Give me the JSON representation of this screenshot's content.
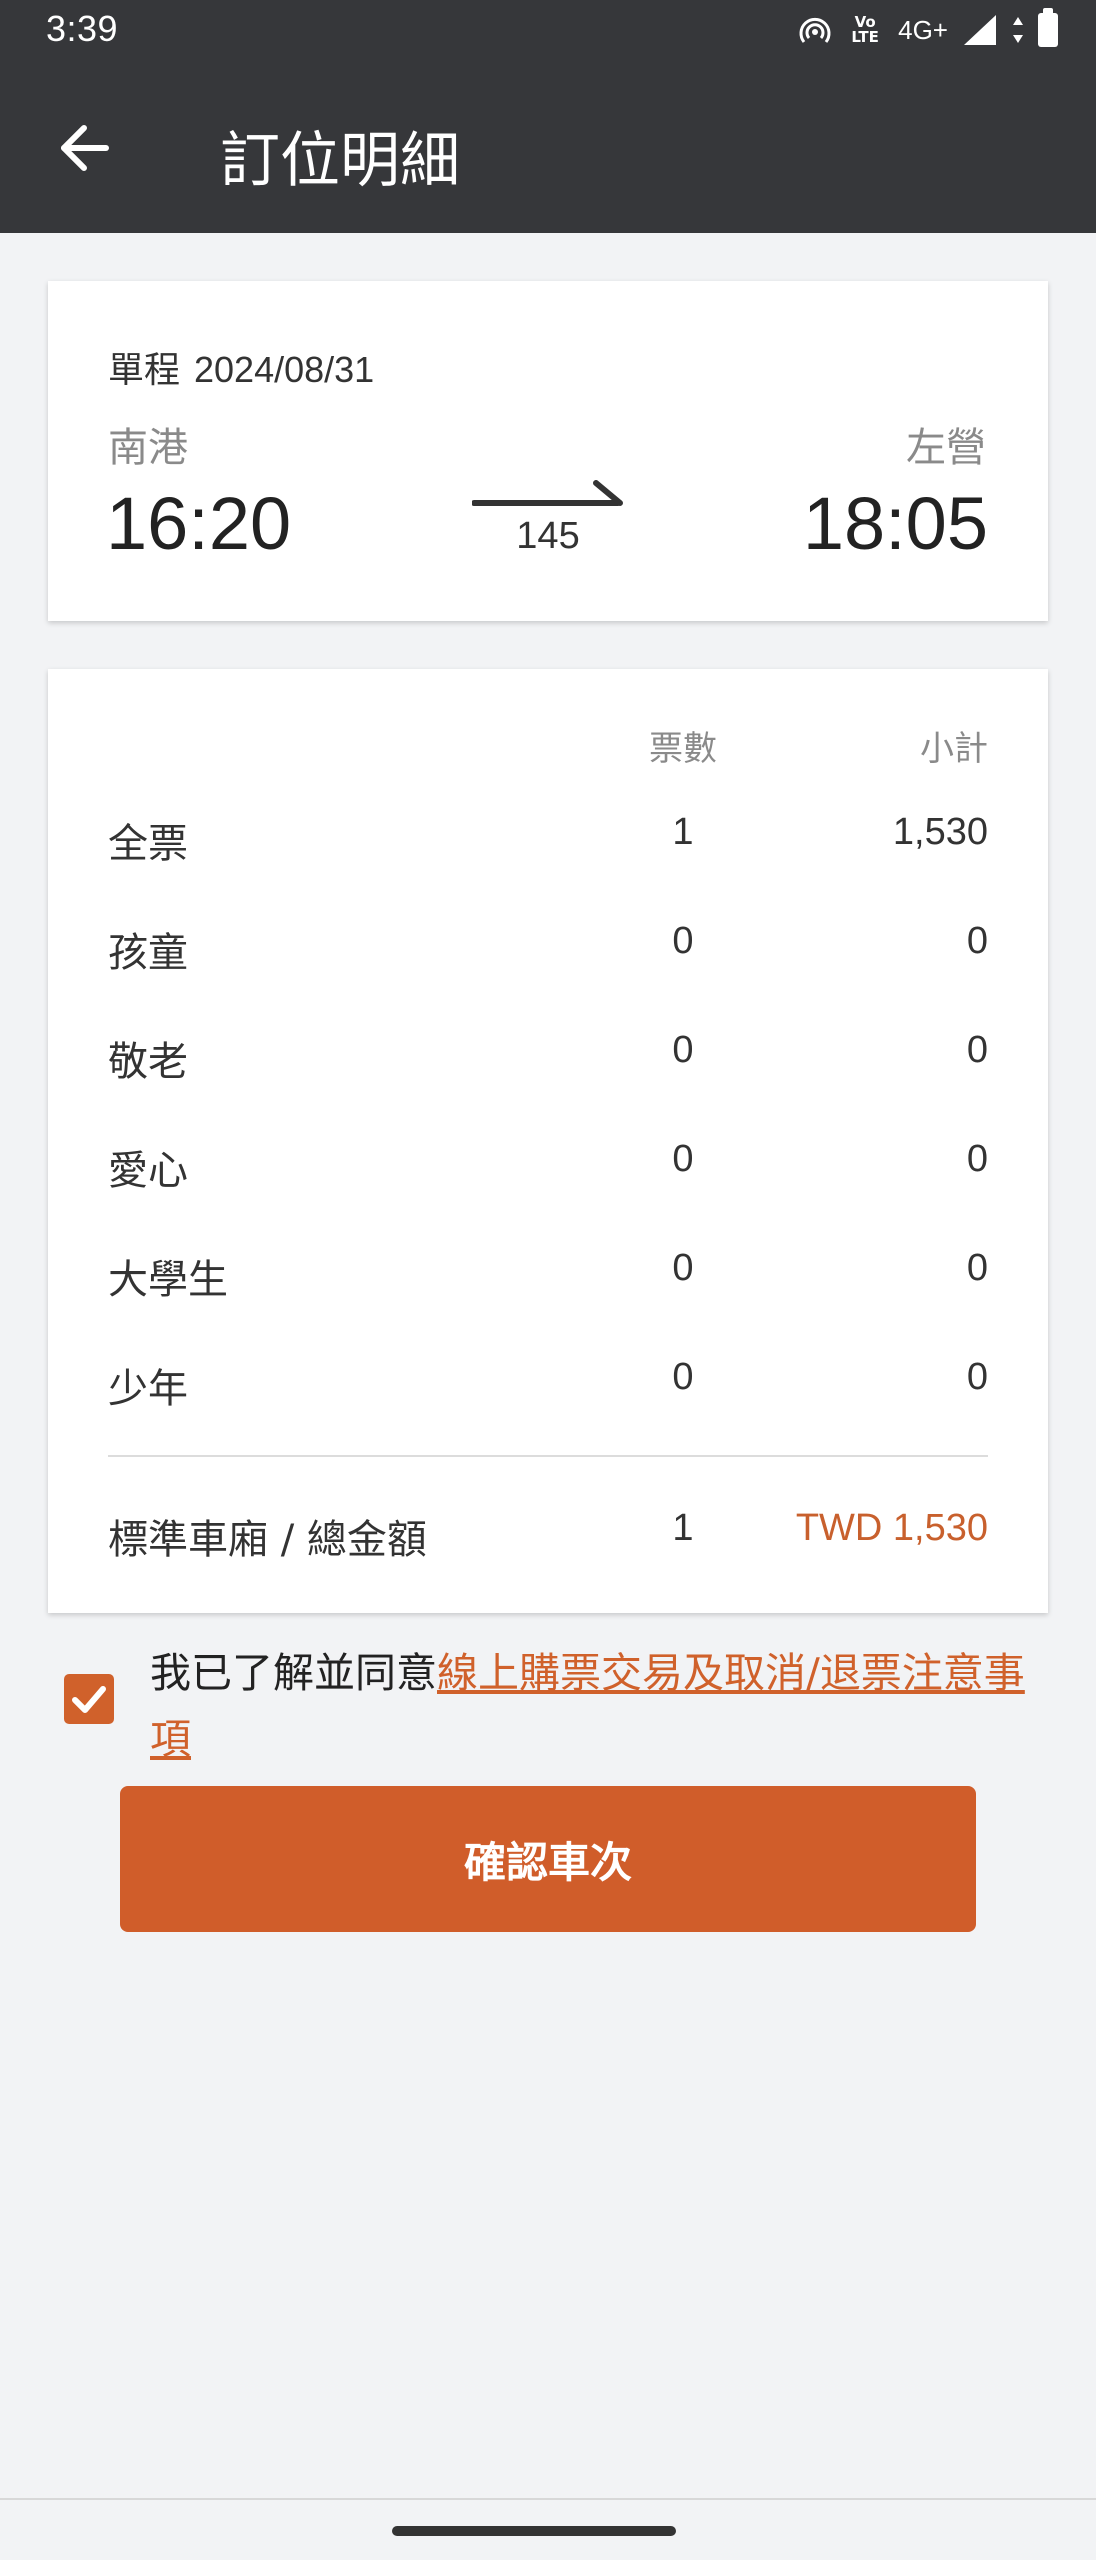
{
  "status_bar": {
    "time": "3:39",
    "volte_top": "Vo",
    "volte_bottom": "LTE",
    "network": "4G+",
    "icons": [
      "hotspot-icon",
      "volte-icon",
      "signal-icon",
      "data-arrows-icon",
      "battery-icon"
    ]
  },
  "app_bar": {
    "back_icon": "arrow-left-icon",
    "title": "訂位明細"
  },
  "trip": {
    "trip_type": "單程",
    "date": "2024/08/31",
    "from_station": "南港",
    "to_station": "左營",
    "departure_time": "16:20",
    "arrival_time": "18:05",
    "train_number": "145"
  },
  "fare_table": {
    "col_count": "票數",
    "col_subtotal": "小計",
    "rows": [
      {
        "name": "全票",
        "count": "1",
        "subtotal": "1,530"
      },
      {
        "name": "孩童",
        "count": "0",
        "subtotal": "0"
      },
      {
        "name": "敬老",
        "count": "0",
        "subtotal": "0"
      },
      {
        "name": "愛心",
        "count": "0",
        "subtotal": "0"
      },
      {
        "name": "大學生",
        "count": "0",
        "subtotal": "0"
      },
      {
        "name": "少年",
        "count": "0",
        "subtotal": "0"
      }
    ],
    "total": {
      "name": "標準車廂 / 總金額",
      "count": "1",
      "amount": "TWD 1,530"
    }
  },
  "agreement": {
    "checked": true,
    "prefix": "我已了解並同意",
    "link_text": "線上購票交易及取消/退票注意事項"
  },
  "confirm_button": {
    "label": "確認車次"
  },
  "colors": {
    "header_bg": "#36373a",
    "accent": "#d05d2a",
    "page_bg": "#f2f3f5"
  }
}
